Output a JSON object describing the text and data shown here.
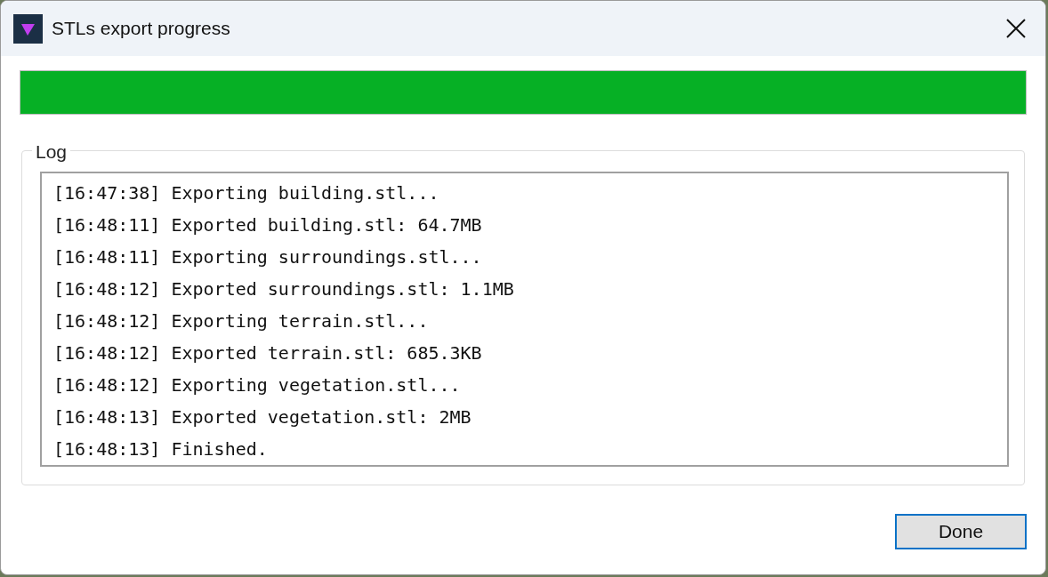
{
  "window": {
    "title": "STLs export progress"
  },
  "progress": {
    "level": 1
  },
  "log": {
    "label": "Log",
    "lines": [
      "[16:47:38] Exporting building.stl...",
      "[16:48:11] Exported building.stl: 64.7MB",
      "[16:48:11] Exporting surroundings.stl...",
      "[16:48:12] Exported surroundings.stl: 1.1MB",
      "[16:48:12] Exporting terrain.stl...",
      "[16:48:12] Exported terrain.stl: 685.3KB",
      "[16:48:12] Exporting vegetation.stl...",
      "[16:48:13] Exported vegetation.stl: 2MB",
      "[16:48:13] Finished."
    ]
  },
  "buttons": [
    "Done"
  ]
}
